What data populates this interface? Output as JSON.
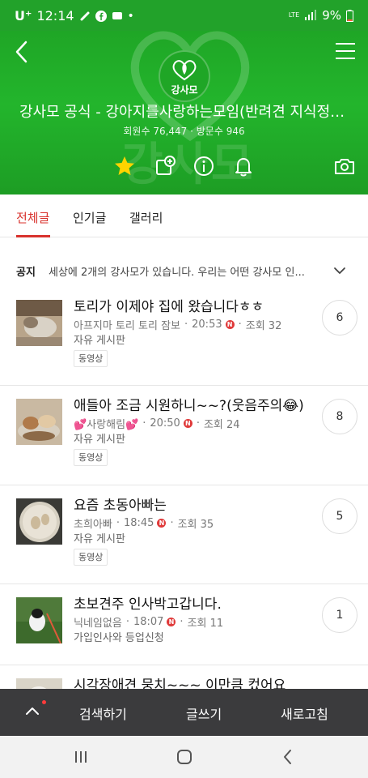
{
  "status_bar": {
    "carrier": "U⁺",
    "time": "12:14",
    "network": "LTE",
    "battery": "9%"
  },
  "header": {
    "logo_text": "강사모",
    "title": "강사모 공식 - 강아지를사랑하는모임(반려견 지식정보 커...",
    "stats": "회원수 76,447 · 방문수 946"
  },
  "tabs": [
    {
      "label": "전체글",
      "active": true
    },
    {
      "label": "인기글",
      "active": false
    },
    {
      "label": "갤러리",
      "active": false
    }
  ],
  "notice": {
    "label": "공지",
    "text": "세상에 2개의 강사모가 있습니다. 우리는 어떤 강사모 인..."
  },
  "posts": [
    {
      "title": "토리가 이제야 집에 왔습니다ㅎㅎ",
      "author": "아프지마 토리 토리 잠보",
      "time": "20:53",
      "views": "조회 32",
      "board": "자유 게시판",
      "tag": "동영상",
      "comments": "6"
    },
    {
      "title": "애들아 조금 시원하니~~?(웃음주의😂)",
      "author": "💕사랑해림💕",
      "time": "20:50",
      "views": "조회 24",
      "board": "자유 게시판",
      "tag": "동영상",
      "comments": "8"
    },
    {
      "title": "요즘 초동아빠는",
      "author": "초희아빠",
      "time": "18:45",
      "views": "조회 35",
      "board": "자유 게시판",
      "tag": "동영상",
      "comments": "5"
    },
    {
      "title": "초보견주 인사박고갑니다.",
      "author": "닉네임없음",
      "time": "18:07",
      "views": "조회 11",
      "board": "가입인사와 등업신청",
      "comments": "1"
    },
    {
      "title": "시각장애견 뭉치~~~ 이만큼 컸어요",
      "comments": ""
    }
  ],
  "new_badge": "N",
  "action_bar": {
    "search": "검색하기",
    "write": "글쓰기",
    "refresh": "새로고침"
  },
  "colors": {
    "header_green": "#22a22a",
    "accent_red": "#d8322d",
    "action_bar": "#3b3b3d"
  }
}
